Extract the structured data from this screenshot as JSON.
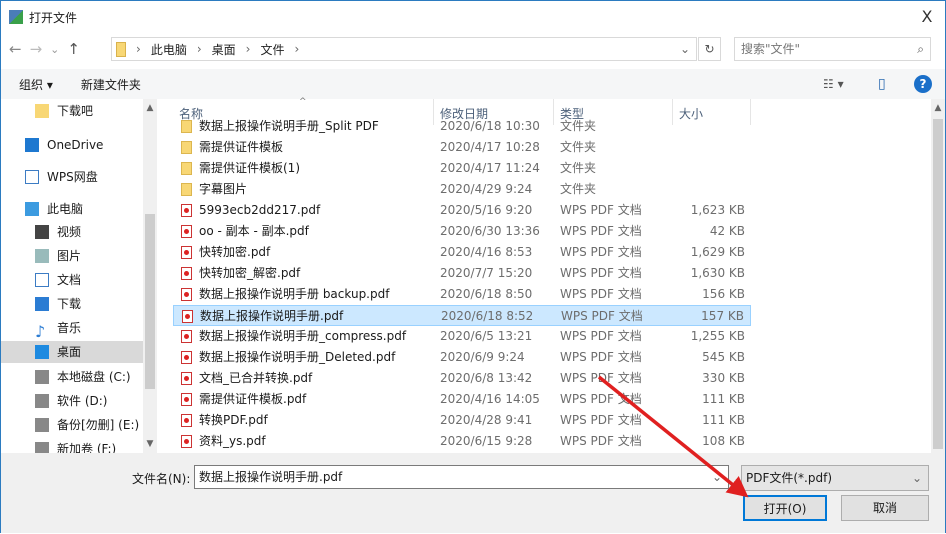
{
  "window": {
    "title": "打开文件",
    "close": "X"
  },
  "nav": {
    "back": "←",
    "forward": "→",
    "recent": "⌄",
    "up": "↑"
  },
  "address": {
    "crumbs": [
      "此电脑",
      "桌面",
      "文件"
    ],
    "sep": "›",
    "dropdown": "⌄",
    "refresh": "↻"
  },
  "search": {
    "placeholder": "搜索\"文件\"",
    "icon": "⌕"
  },
  "toolbar": {
    "organize": "组织 ▾",
    "new_folder": "新建文件夹",
    "view": "☷ ▾",
    "pane": "▯",
    "help": "?"
  },
  "sidebar": {
    "items": [
      {
        "label": "下载吧",
        "icon": "folder-icon"
      },
      {
        "label": "OneDrive",
        "icon": "cloud-icon"
      },
      {
        "label": "WPS网盘",
        "icon": "cloud-outline-icon"
      },
      {
        "label": "此电脑",
        "icon": "computer-icon"
      },
      {
        "label": "视频",
        "icon": "video-icon"
      },
      {
        "label": "图片",
        "icon": "picture-icon"
      },
      {
        "label": "文档",
        "icon": "document-icon"
      },
      {
        "label": "下载",
        "icon": "download-icon"
      },
      {
        "label": "音乐",
        "icon": "music-icon"
      },
      {
        "label": "桌面",
        "icon": "desktop-icon",
        "selected": true
      },
      {
        "label": "本地磁盘 (C:)",
        "icon": "drive-icon"
      },
      {
        "label": "软件 (D:)",
        "icon": "drive-icon"
      },
      {
        "label": "备份[勿删] (E:)",
        "icon": "drive-icon"
      },
      {
        "label": "新加卷 (F:)",
        "icon": "drive-icon"
      }
    ]
  },
  "columns": {
    "name": "名称",
    "date": "修改日期",
    "type": "类型",
    "size": "大小"
  },
  "files": [
    {
      "name": "数据上报操作说明手册_Split PDF",
      "date": "2020/6/18 10:30",
      "type": "文件夹",
      "size": "",
      "kind": "folder"
    },
    {
      "name": "需提供证件模板",
      "date": "2020/4/17 10:28",
      "type": "文件夹",
      "size": "",
      "kind": "folder"
    },
    {
      "name": "需提供证件模板(1)",
      "date": "2020/4/17 11:24",
      "type": "文件夹",
      "size": "",
      "kind": "folder"
    },
    {
      "name": "字幕图片",
      "date": "2020/4/29 9:24",
      "type": "文件夹",
      "size": "",
      "kind": "folder"
    },
    {
      "name": "5993ecb2dd217.pdf",
      "date": "2020/5/16 9:20",
      "type": "WPS PDF 文档",
      "size": "1,623 KB",
      "kind": "pdf"
    },
    {
      "name": "oo - 副本 - 副本.pdf",
      "date": "2020/6/30 13:36",
      "type": "WPS PDF 文档",
      "size": "42 KB",
      "kind": "pdf"
    },
    {
      "name": "快转加密.pdf",
      "date": "2020/4/16 8:53",
      "type": "WPS PDF 文档",
      "size": "1,629 KB",
      "kind": "pdf"
    },
    {
      "name": "快转加密_解密.pdf",
      "date": "2020/7/7 15:20",
      "type": "WPS PDF 文档",
      "size": "1,630 KB",
      "kind": "pdf"
    },
    {
      "name": "数据上报操作说明手册 backup.pdf",
      "date": "2020/6/18 8:50",
      "type": "WPS PDF 文档",
      "size": "156 KB",
      "kind": "pdf"
    },
    {
      "name": "数据上报操作说明手册.pdf",
      "date": "2020/6/18 8:52",
      "type": "WPS PDF 文档",
      "size": "157 KB",
      "kind": "pdf",
      "selected": true
    },
    {
      "name": "数据上报操作说明手册_compress.pdf",
      "date": "2020/6/5 13:21",
      "type": "WPS PDF 文档",
      "size": "1,255 KB",
      "kind": "pdf"
    },
    {
      "name": "数据上报操作说明手册_Deleted.pdf",
      "date": "2020/6/9 9:24",
      "type": "WPS PDF 文档",
      "size": "545 KB",
      "kind": "pdf"
    },
    {
      "name": "文档_已合并转换.pdf",
      "date": "2020/6/8 13:42",
      "type": "WPS PDF 文档",
      "size": "330 KB",
      "kind": "pdf"
    },
    {
      "name": "需提供证件模板.pdf",
      "date": "2020/4/16 14:05",
      "type": "WPS PDF 文档",
      "size": "111 KB",
      "kind": "pdf"
    },
    {
      "name": "转换PDF.pdf",
      "date": "2020/4/28 9:41",
      "type": "WPS PDF 文档",
      "size": "111 KB",
      "kind": "pdf"
    },
    {
      "name": "资料_ys.pdf",
      "date": "2020/6/15 9:28",
      "type": "WPS PDF 文档",
      "size": "108 KB",
      "kind": "pdf"
    }
  ],
  "footer": {
    "filename_label": "文件名(N):",
    "filename_value": "数据上报操作说明手册.pdf",
    "filter": "PDF文件(*.pdf)",
    "open": "打开(O)",
    "cancel": "取消"
  },
  "colors": {
    "accent": "#0078d7",
    "selected_row": "#cce8ff",
    "arrow": "#e02020"
  }
}
